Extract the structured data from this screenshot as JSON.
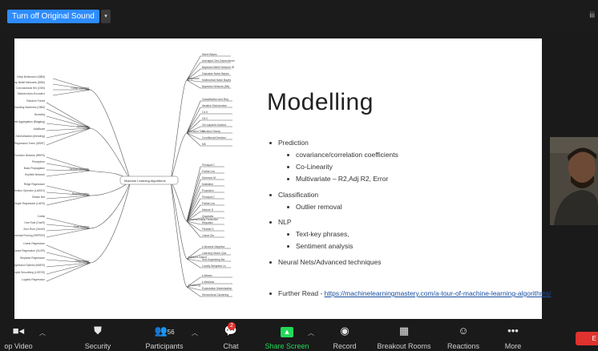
{
  "topbar": {
    "original_sound_button": "Turn off Original Sound",
    "caret": "▾",
    "grid_icon": "iii"
  },
  "slide": {
    "title": "Modelling",
    "bullets": {
      "prediction": "Prediction",
      "covariance": "covariance/correlation coefficients",
      "colinearity": "Co-Linearity",
      "multivariate": "Multivariate – R2,Adj R2, Error",
      "classification": "Classification",
      "outlier": "Outlier removal",
      "nlp": "NLP",
      "textkey": "Text-key phrases,",
      "sentiment": "Sentiment analysis",
      "neural": "Neural Nets/Advanced techniques",
      "further_label": "Further Read - ",
      "further_link": "https://machinelearningmastery.com/a-tour-of-machine-learning-algorithms/"
    },
    "mindmap": {
      "center": "Machine Learning Algorithms",
      "left_groups": [
        "Deep Learning",
        "Ensemble",
        "Neural Networks",
        "Regularization",
        "Rule System",
        "Regression"
      ],
      "right_groups": [
        "Bayesian",
        "Decision Tree",
        "Dimensionality Reduction",
        "Instance Based",
        "Clustering"
      ],
      "bayesian_items": [
        "Naive Bayes",
        "Averaged One-Dependence",
        "Bayesian Belief Network (B",
        "Gaussian Naive Bayes",
        "Multinomial Naive Bayes",
        "Bayesian Network (BN)"
      ],
      "tree_items": [
        "Classification and Reg",
        "Iterative Dichotomise",
        "C4.5",
        "C5.0",
        "Chi-squared Automa",
        "Decision Stump",
        "Conditional Decision",
        "M5"
      ],
      "dim_items": [
        "Principal C",
        "Partial Lea",
        "Sammon M",
        "Multidime",
        "Projection",
        "Principal C",
        "Partial Lea",
        "Mixture D",
        "Quadratic",
        "Regulariz",
        "Flexible D",
        "Linear Dis"
      ],
      "instance_items": [
        "k-Nearest Neighbor",
        "Learning Vector Qua",
        "Self-Organizing Ma",
        "Locally Weighted Le"
      ],
      "cluster_items": [
        "k-Means",
        "k-Medians",
        "Expectation Maximisation",
        "Hierarchical Clustering"
      ],
      "deep_items": [
        "Deep Boltzmann (DBM)",
        "Deep Belief Networks (DBN)",
        "Convolutional NN (CNN)",
        "Stacked Auto-Encoders"
      ],
      "ensemble_items": [
        "Random Forest",
        "Gradient Boosting Machines (GBM)",
        "Boosting",
        "Bootstrapped Aggregation (Bagging)",
        "AdaBoost",
        "Stacked Generalization (blending)",
        "Gradient Boosted Regression Trees (GBRT)"
      ],
      "nn_items": [
        "Radial Basis Function Network (RBFN)",
        "Perceptron",
        "Back-Propagation",
        "Hopfield Network"
      ],
      "reg_items": [
        "Ridge Regression",
        "Least Absolute Shrinkage and Selection Operator (LASSO)",
        "Elastic Net",
        "Least Angle Regression (LARS)"
      ],
      "rule_items": [
        "Cubist",
        "One Rule (OneR)",
        "Zero Rule (ZeroR)",
        "Repeated Incremental Pruning (RIPPER)"
      ],
      "regression_items": [
        "Linear Regression",
        "Ordinary Least Squares Regression (OLSR)",
        "Stepwise Regression",
        "Multivariate Adaptive Regression Splines (MARS)",
        "Locally Estimated Scatterplot Smoothing (LOESS)",
        "Logistic Regression"
      ]
    }
  },
  "toolbar": {
    "stop_video": "op Video",
    "security": "Security",
    "participants": "Participants",
    "participants_count": "56",
    "chat": "Chat",
    "chat_badge": "2",
    "share_screen": "Share Screen",
    "record": "Record",
    "breakout_rooms": "Breakout Rooms",
    "reactions": "Reactions",
    "more": "More",
    "end": "E"
  },
  "colors": {
    "accent": "#2d8cff",
    "share_green": "#23d959",
    "end_red": "#e0322f"
  }
}
